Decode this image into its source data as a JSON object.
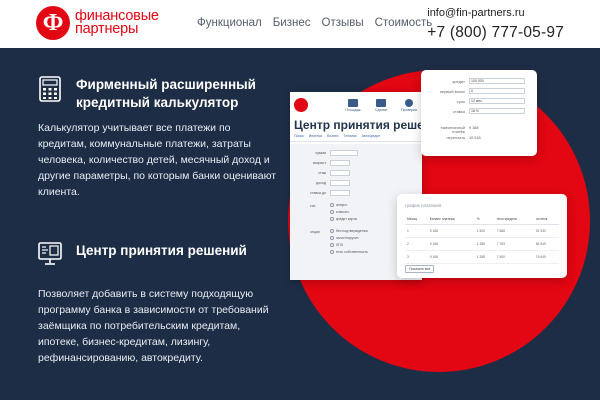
{
  "header": {
    "logo_line1": "финансовые",
    "logo_line2": "партнеры",
    "nav": [
      "Функционал",
      "Бизнес",
      "Отзывы",
      "Стоимость"
    ],
    "email": "info@fin-partners.ru",
    "phone": "+7 (800) 777-05-97"
  },
  "features": [
    {
      "icon": "calculator-icon",
      "title_line1": "Фирменный расширенный",
      "title_line2": "кредитный калькулятор",
      "text": "Калькулятор учитывает все платежи по кредитам, коммунальные платежи, затраты человека, количество детей, месячный доход и другие параметры, по которым банки оценивают клиента."
    },
    {
      "icon": "monitor-icon",
      "title_line1": "Центр принятия решений",
      "text": "Позволяет добавить в систему подходящую программу банка в зависимости от требований заёмщика по потребительским кредитам, ипотеке, бизнес-кредитам, лизингу, рефинансированию, автокредиту."
    }
  ],
  "app_preview": {
    "title": "Центр принятия решени",
    "tools": [
      "Площадь",
      "Сделки",
      "Проверка"
    ],
    "tabs": [
      "Поиск",
      "Ипотека",
      "Бизнес",
      "Техника",
      "Автокредит"
    ],
    "fields": [
      "сумма",
      "возраст",
      "стаж",
      "доход",
      "ставка до"
    ],
    "option_group_1_label": "тип",
    "option_group_1": [
      "аннуит.",
      "классич.",
      "кредит карта"
    ],
    "option_group_2_label": "опции",
    "option_group_2": [
      "без подтверждения",
      "залог/поручит.",
      "ЛПХ",
      "есть собственность"
    ]
  },
  "calc_card": {
    "rows": [
      {
        "label": "кредит",
        "value": "100 000"
      },
      {
        "label": "первый взнос",
        "value": "0"
      },
      {
        "label": "срок",
        "value": "12 мес"
      },
      {
        "label": "ставка",
        "value": "18 %"
      }
    ],
    "results": [
      {
        "label": "ежемесячный платёж",
        "value": "9 168"
      },
      {
        "label": "переплата",
        "value": "10 018"
      }
    ]
  },
  "schedule_card": {
    "title": "график платежей",
    "columns": [
      "Месяц",
      "Баланс платежа",
      "%",
      "тело кредита",
      "остаток"
    ],
    "rows": [
      [
        "1",
        "9 168",
        "1 500",
        "7 668",
        "92 332"
      ],
      [
        "2",
        "9 168",
        "1 385",
        "7 783",
        "84 549"
      ],
      [
        "3",
        "9 168",
        "1 268",
        "7 900",
        "76 649"
      ]
    ],
    "button": "Показать всё"
  },
  "colors": {
    "brand_red": "#e30613",
    "background_navy": "#1e2d46"
  }
}
